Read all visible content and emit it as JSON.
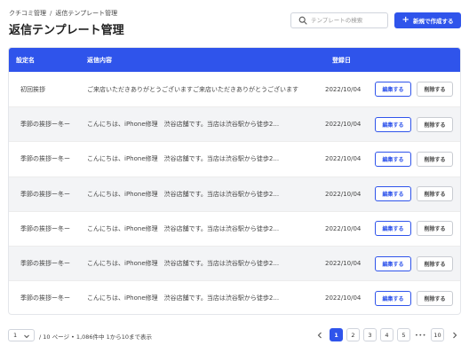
{
  "breadcrumb": {
    "root": "クチコミ管理",
    "current": "返信テンプレート管理"
  },
  "page_title": "返信テンプレート管理",
  "search": {
    "placeholder": "テンプレートの検索",
    "icon": "search-icon"
  },
  "new_button": {
    "label": "新規で作成する",
    "icon": "plus-icon"
  },
  "table": {
    "columns": {
      "name": "設定名",
      "content": "返信内容",
      "date": "登録日"
    },
    "rows": [
      {
        "name": "初回挨拶",
        "content": "ご来店いただきありがとうございますご来店いただきありがとうございます",
        "date": "2022/10/04",
        "edit": "編集する",
        "delete": "削除する"
      },
      {
        "name": "季節の挨拶ー冬ー",
        "content": "こんにちは、iPhone修理　渋谷店舗です。当店は渋谷駅から徒歩2...",
        "date": "2022/10/04",
        "edit": "編集する",
        "delete": "削除する"
      },
      {
        "name": "季節の挨拶ー冬ー",
        "content": "こんにちは、iPhone修理　渋谷店舗です。当店は渋谷駅から徒歩2...",
        "date": "2022/10/04",
        "edit": "編集する",
        "delete": "削除する"
      },
      {
        "name": "季節の挨拶ー冬ー",
        "content": "こんにちは、iPhone修理　渋谷店舗です。当店は渋谷駅から徒歩2...",
        "date": "2022/10/04",
        "edit": "編集する",
        "delete": "削除する"
      },
      {
        "name": "季節の挨拶ー冬ー",
        "content": "こんにちは、iPhone修理　渋谷店舗です。当店は渋谷駅から徒歩2...",
        "date": "2022/10/04",
        "edit": "編集する",
        "delete": "削除する"
      },
      {
        "name": "季節の挨拶ー冬ー",
        "content": "こんにちは、iPhone修理　渋谷店舗です。当店は渋谷駅から徒歩2...",
        "date": "2022/10/04",
        "edit": "編集する",
        "delete": "削除する"
      },
      {
        "name": "季節の挨拶ー冬ー",
        "content": "こんにちは、iPhone修理　渋谷店舗です。当店は渋谷駅から徒歩2...",
        "date": "2022/10/04",
        "edit": "編集する",
        "delete": "削除する"
      }
    ]
  },
  "footer": {
    "page_select_value": "1",
    "info": "/ 10 ページ • 1,086件中 1から10まで表示",
    "pages": [
      "1",
      "2",
      "3",
      "4",
      "5"
    ],
    "ellipsis": "•••",
    "last_page": "10",
    "current_page": "1"
  },
  "colors": {
    "accent": "#2f54eb",
    "row_alt": "#f3f4f6"
  }
}
